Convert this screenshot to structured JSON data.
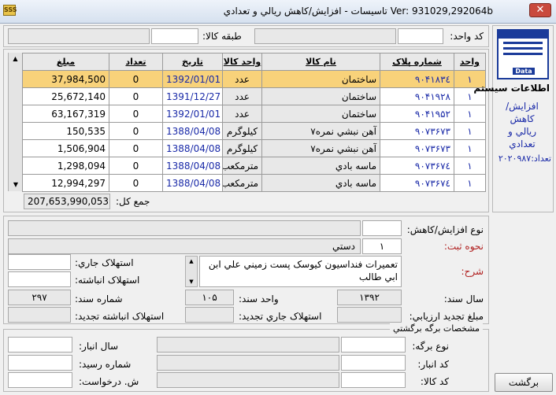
{
  "window": {
    "title": "Ver: 931029,292064b   تاسیسات - افزایش/کاهش ريالي و تعدادي",
    "close_glyph": "✕",
    "app_icon_text": "SSS"
  },
  "header": {
    "unit_code_label": "کد واحد:",
    "goods_class_label": "طبقه کالا:"
  },
  "grid": {
    "columns": [
      "واحد",
      "شماره پلاک",
      "نام کالا",
      "واحد کالا",
      "تاریخ",
      "تعداد",
      "مبلغ"
    ],
    "rows": [
      {
        "unit": "۱",
        "plate": "۹۰۴۱۸۳٤",
        "name": "ساختمان",
        "uom": "عدد",
        "date": "1392/01/01",
        "qty": "0",
        "amount": "37,984,500",
        "selected": true
      },
      {
        "unit": "۱",
        "plate": "۹۰۴۱۹۲۸",
        "name": "ساختمان",
        "uom": "عدد",
        "date": "1391/12/27",
        "qty": "0",
        "amount": "25,672,140",
        "selected": false
      },
      {
        "unit": "۱",
        "plate": "۹۰۴۱۹۵۲",
        "name": "ساختمان",
        "uom": "عدد",
        "date": "1392/01/01",
        "qty": "0",
        "amount": "63,167,319",
        "selected": false
      },
      {
        "unit": "۱",
        "plate": "۹۰۷۳۶۷۳",
        "name": "آهن نبشي نمره۷",
        "uom": "کيلوگرم",
        "date": "1388/04/08",
        "qty": "0",
        "amount": "150,535",
        "selected": false
      },
      {
        "unit": "۱",
        "plate": "۹۰۷۳۶۷۳",
        "name": "آهن نبشي نمره۷",
        "uom": "کيلوگرم",
        "date": "1388/04/08",
        "qty": "0",
        "amount": "1,506,904",
        "selected": false
      },
      {
        "unit": "۱",
        "plate": "۹۰۷۳۶۷٤",
        "name": "ماسه بادي",
        "uom": "مترمکعب",
        "date": "1388/04/08",
        "qty": "0",
        "amount": "1,298,094",
        "selected": false
      },
      {
        "unit": "۱",
        "plate": "۹۰۷۳۶۷٤",
        "name": "ماسه بادي",
        "uom": "مترمکعب",
        "date": "1388/04/08",
        "qty": "0",
        "amount": "12,994,297",
        "selected": false
      }
    ],
    "total_label": "جمع کل:",
    "total_value": "207,653,990,053"
  },
  "side": {
    "icon_caption": "Data",
    "system_info_label": "اطلاعات سيستم",
    "module_title": "افزايش/\nکاهش\nريالي و\nتعدادي",
    "count_label": "تعداد:",
    "count_value": "۲۰۲۰۹۸۷"
  },
  "form": {
    "change_type_label": "نوع افزايش/کاهش:",
    "register_method_label": "نحوه ثبت:",
    "register_method_code": "۱",
    "register_method_value": "دستي",
    "description_label": "شرح:",
    "description_text": "تعميرات فنداسيون کيوسک پست زميني علي ابن ابي طالب",
    "current_depreciation_label": "استهلاک جاري:",
    "accumulated_depreciation_label": "استهلاک انباشته:",
    "doc_year_label": "سال سند:",
    "doc_year_value": "۱۳۹۲",
    "doc_unit_label": "واحد سند:",
    "doc_unit_value": "۱۰۵",
    "doc_number_label": "شماره سند:",
    "doc_number_value": "۲۹۷",
    "revaluation_amount_label": "مبلغ تجديد ارزيابي:",
    "revaluation_current_dep_label": "استهلاک جاري تجديد:",
    "revaluation_accum_dep_label": "استهلاک انباشته تجديد:"
  },
  "return_slip": {
    "section_title": "مشخصات برگه برگشتي",
    "slip_type_label": "نوع برگه:",
    "warehouse_code_label": "کد انبار:",
    "goods_code_label": "کد کالا:",
    "warehouse_year_label": "سال انبار:",
    "receipt_number_label": "شماره رسيد:",
    "request_number_label": "ش. درخواست:"
  },
  "buttons": {
    "return_label": "برگشت"
  },
  "colors": {
    "selected_row": "#f8d27a",
    "link_blue": "#1a2aa8",
    "label_red": "#b02020"
  }
}
